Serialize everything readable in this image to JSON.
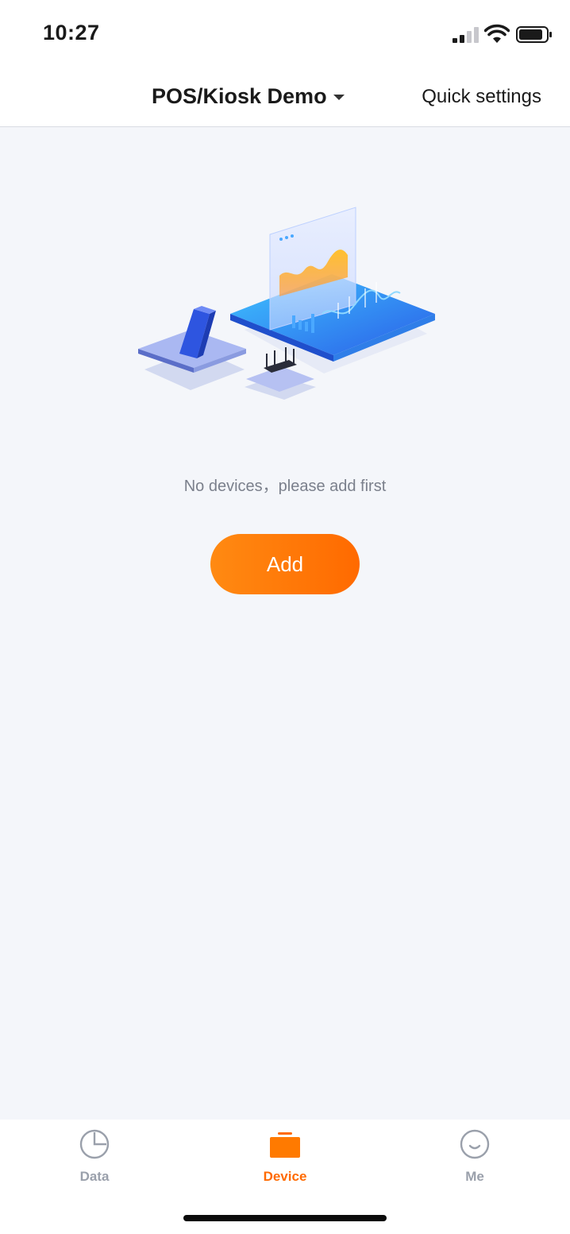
{
  "status_bar": {
    "time": "10:27",
    "icons": [
      "signal-icon",
      "wifi-icon",
      "battery-icon"
    ]
  },
  "header": {
    "title": "POS/Kiosk Demo",
    "title_icon": "caret-down-icon",
    "quick_settings_label": "Quick settings"
  },
  "empty_state": {
    "illustration": "devices-illustration",
    "message": "No devices，please add first",
    "add_button_label": "Add"
  },
  "tab_bar": {
    "tabs": [
      {
        "label": "Data",
        "icon": "pie-chart-icon",
        "active": false
      },
      {
        "label": "Device",
        "icon": "device-box-icon",
        "active": true
      },
      {
        "label": "Me",
        "icon": "smiley-icon",
        "active": false
      }
    ]
  },
  "colors": {
    "accent": "#ff6a00",
    "accent_light": "#ff8a12",
    "background": "#f4f6fa",
    "inactive_tab": "#9aa0ab",
    "muted_text": "#7b808c"
  }
}
